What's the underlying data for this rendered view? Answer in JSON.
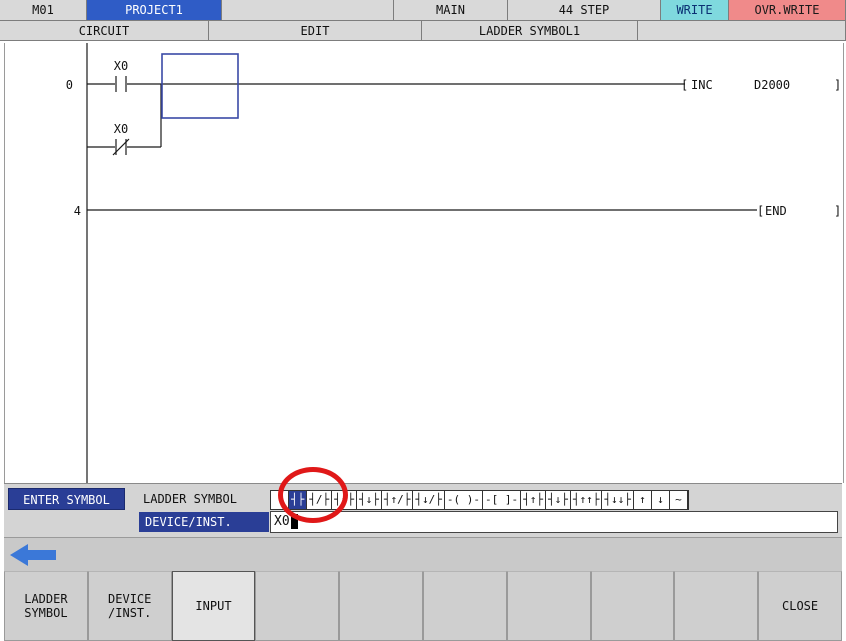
{
  "status_bar": {
    "machine": "M01",
    "project": "PROJECT1",
    "program": "MAIN",
    "step": "44 STEP",
    "mode_write": "WRITE",
    "mode_ovr": "OVR.WRITE"
  },
  "menu": {
    "circuit": "CIRCUIT",
    "edit": "EDIT",
    "ladder_symbol": "LADDER SYMBOL1"
  },
  "ladder": {
    "rungs": [
      {
        "step": "0",
        "instruction": "INC",
        "operand": "D2000"
      },
      {
        "step": "4",
        "instruction": "END",
        "operand": ""
      }
    ],
    "contacts": [
      {
        "device": "X0",
        "type": "no-contact"
      },
      {
        "device": "X0",
        "type": "nc-contact"
      }
    ],
    "colors": {
      "cursor": "#3a4aa6",
      "line": "#1a1a1a"
    }
  },
  "entry": {
    "enter_symbol": "ENTER SYMBOL",
    "ladder_symbol_label": "LADDER SYMBOL",
    "device_label": "DEVICE/INST.",
    "device_value": "X0",
    "symbols": [
      "",
      "┤├",
      "┤/├",
      "┤↑├",
      "┤↓├",
      "┤↑/├",
      "┤↓/├",
      "-( )-",
      "-[ ]-",
      "┤↑├",
      "┤↓├",
      "┤↑↑├",
      "┤↓↓├",
      "↑",
      "↓",
      "~"
    ],
    "selected_symbol_index": 1
  },
  "nav": {
    "back_icon": "left-arrow-icon",
    "accent": "#3b78d8"
  },
  "function_keys": [
    {
      "label": "LADDER\nSYMBOL",
      "active": false
    },
    {
      "label": "DEVICE\n/INST.",
      "active": false
    },
    {
      "label": "INPUT",
      "active": true
    },
    {
      "label": "",
      "active": false
    },
    {
      "label": "",
      "active": false
    },
    {
      "label": "",
      "active": false
    },
    {
      "label": "",
      "active": false
    },
    {
      "label": "",
      "active": false
    },
    {
      "label": "",
      "active": false
    },
    {
      "label": "CLOSE",
      "active": false
    }
  ]
}
